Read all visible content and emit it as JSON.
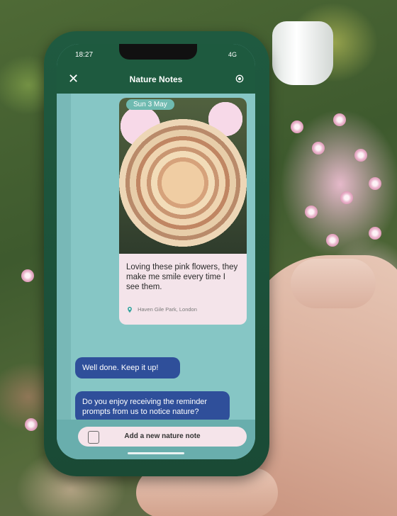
{
  "status": {
    "time": "18:27",
    "signal": "4G"
  },
  "app": {
    "title": "Nature Notes"
  },
  "note": {
    "date": "Sun 3 May",
    "text": "Loving these pink flowers, they make me smile every time I see them.",
    "location": "Haven Gile Park, London"
  },
  "messages": [
    {
      "text": "Well done. Keep it up!"
    },
    {
      "text": "Do you enjoy receiving the reminder prompts from us to notice nature?"
    }
  ],
  "actions": {
    "add_note": "Add a new nature note"
  },
  "icons": {
    "close": "close-icon",
    "settings": "gear-icon",
    "location": "location-pin-icon",
    "note": "note-icon"
  },
  "colors": {
    "header": "#1e5a3f",
    "screen_bg": "#86c6c5",
    "bubble": "#2f4f9a",
    "card": "#f4e4ea"
  }
}
